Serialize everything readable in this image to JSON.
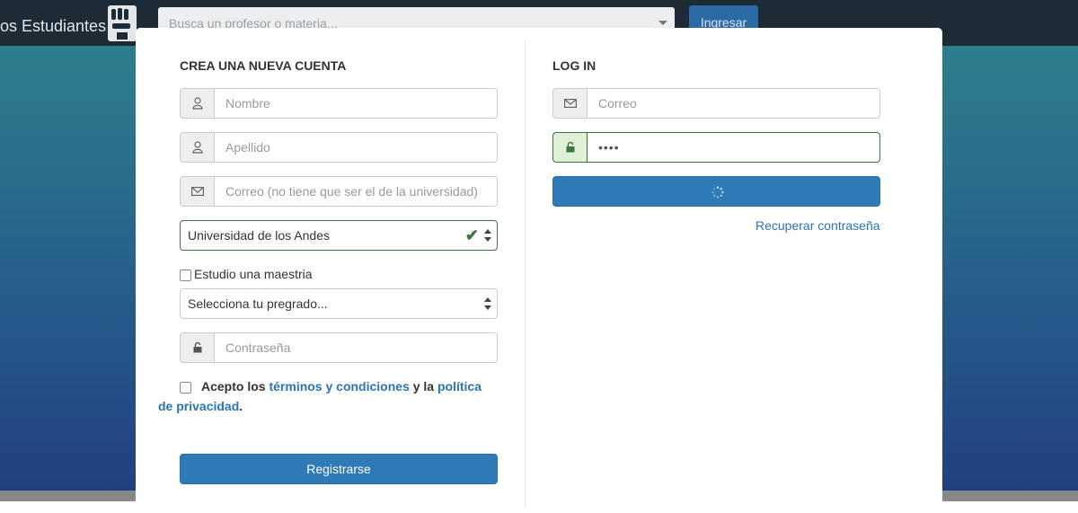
{
  "topbar": {
    "brand_text": "os Estudiantes",
    "brand_icon": "fist-icon",
    "search_placeholder": "Busca un profesor o materia...",
    "login_button": "Ingresar"
  },
  "register": {
    "title": "CREA UNA NUEVA CUENTA",
    "nombre_placeholder": "Nombre",
    "apellido_placeholder": "Apellido",
    "correo_placeholder": "Correo (no tiene que ser el de la universidad)",
    "university_value": "Universidad de los Andes",
    "maestria_label": "Estudio una maestria",
    "pregrado_value": "Selecciona tu pregrado...",
    "password_placeholder": "Contraseña",
    "terms_prefix": "Acepto los ",
    "terms_link": "términos y condiciones",
    "terms_middle": " y la ",
    "privacy_link_1": "política",
    "privacy_link_2": "de privacidad",
    "terms_suffix": ".",
    "submit_button": "Registrarse"
  },
  "login": {
    "title": "LOG IN",
    "correo_placeholder": "Correo",
    "password_value": "••••",
    "recover_link": "Recuperar contraseña"
  },
  "colors": {
    "topbar": "#1d2b36",
    "primary": "#2e7bb8",
    "success": "#3c763d",
    "link": "#2a75b3"
  }
}
